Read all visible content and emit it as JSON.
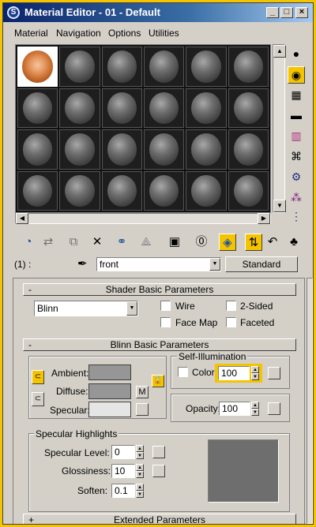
{
  "window": {
    "title": "Material Editor - 01 - Default",
    "controls": [
      "_",
      "□",
      "×"
    ]
  },
  "menu": [
    "Material",
    "Navigation",
    "Options",
    "Utilities"
  ],
  "name_row": {
    "level": "(1) :",
    "material_name": "front",
    "type_button": "Standard"
  },
  "shader_rollout": {
    "title": "Shader Basic Parameters",
    "toggle": "-",
    "shader": "Blinn",
    "options": {
      "wire": "Wire",
      "two_sided": "2-Sided",
      "face_map": "Face Map",
      "faceted": "Faceted"
    }
  },
  "blinn_rollout": {
    "title": "Blinn Basic Parameters",
    "toggle": "-",
    "ambient": "Ambient:",
    "diffuse": "Diffuse:",
    "specular": "Specular:",
    "map_button": "M",
    "self_illum": {
      "title": "Self-Illumination",
      "color_label": "Color",
      "value": "100"
    },
    "opacity": {
      "label": "Opacity:",
      "value": "100"
    },
    "highlights": {
      "title": "Specular Highlights",
      "specular_level_label": "Specular Level:",
      "specular_level": "0",
      "glossiness_label": "Glossiness:",
      "glossiness": "10",
      "soften_label": "Soften:",
      "soften": "0.1"
    }
  },
  "extended_rollout": {
    "title": "Extended Parameters",
    "toggle": "+"
  },
  "colors": {
    "title_bar": "#0a246a",
    "frame": "#f5c400",
    "highlight_field": "#f5c400",
    "ambient_swatch": "#969696",
    "diffuse_swatch": "#969696",
    "specular_swatch": "#e5e5e5",
    "highlight_curve_bg": "#6e6e6e"
  }
}
